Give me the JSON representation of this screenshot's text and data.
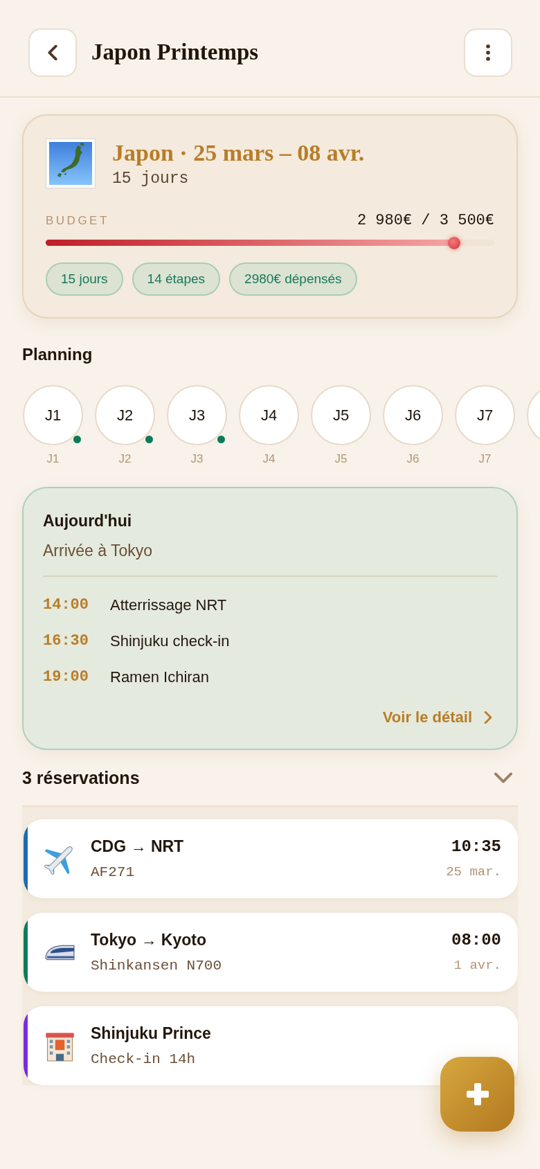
{
  "header": {
    "title": "Japon Printemps"
  },
  "trip": {
    "title": "Japon · 25 mars – 08 avr.",
    "subtitle": "15 jours",
    "budget_label": "BUDGET",
    "budget_amount": "2 980€ / 3 500€",
    "level": 0.91,
    "chips": [
      "15 jours",
      "14 étapes",
      "2980€ dépensés"
    ]
  },
  "planning": {
    "title": "Planning",
    "days": [
      {
        "label": "J1",
        "caption": "J1",
        "done": true
      },
      {
        "label": "J2",
        "caption": "J2",
        "done": true
      },
      {
        "label": "J3",
        "caption": "J3",
        "done": true
      },
      {
        "label": "J4",
        "caption": "J4",
        "done": false
      },
      {
        "label": "J5",
        "caption": "J5",
        "done": false
      },
      {
        "label": "J6",
        "caption": "J6",
        "done": false
      },
      {
        "label": "J7",
        "caption": "J7",
        "done": false
      }
    ],
    "more_days": true
  },
  "today": {
    "title": "Aujourd'hui",
    "subtitle": "Arrivée à Tokyo",
    "events": [
      {
        "time": "14:00",
        "text": "Atterrissage NRT"
      },
      {
        "time": "16:30",
        "text": "Shinjuku check-in"
      },
      {
        "time": "19:00",
        "text": "Ramen Ichiran"
      }
    ],
    "link": "Voir le détail"
  },
  "reservations": {
    "title": "3 réservations",
    "expanded": true,
    "items": [
      {
        "kind": "flight",
        "title": "CDG → NRT",
        "subtitle": "AF271",
        "time": "10:35",
        "date": "25 mar.",
        "color": "#1a6db3"
      },
      {
        "kind": "train",
        "title": "Tokyo → Kyoto",
        "subtitle": "Shinkansen N700",
        "time": "08:00",
        "date": "1 avr.",
        "color": "#0f7a5a"
      },
      {
        "kind": "hotel",
        "title": "Shinjuku Prince",
        "subtitle": "Check-in 14h",
        "color": "#7a2be0"
      }
    ]
  }
}
